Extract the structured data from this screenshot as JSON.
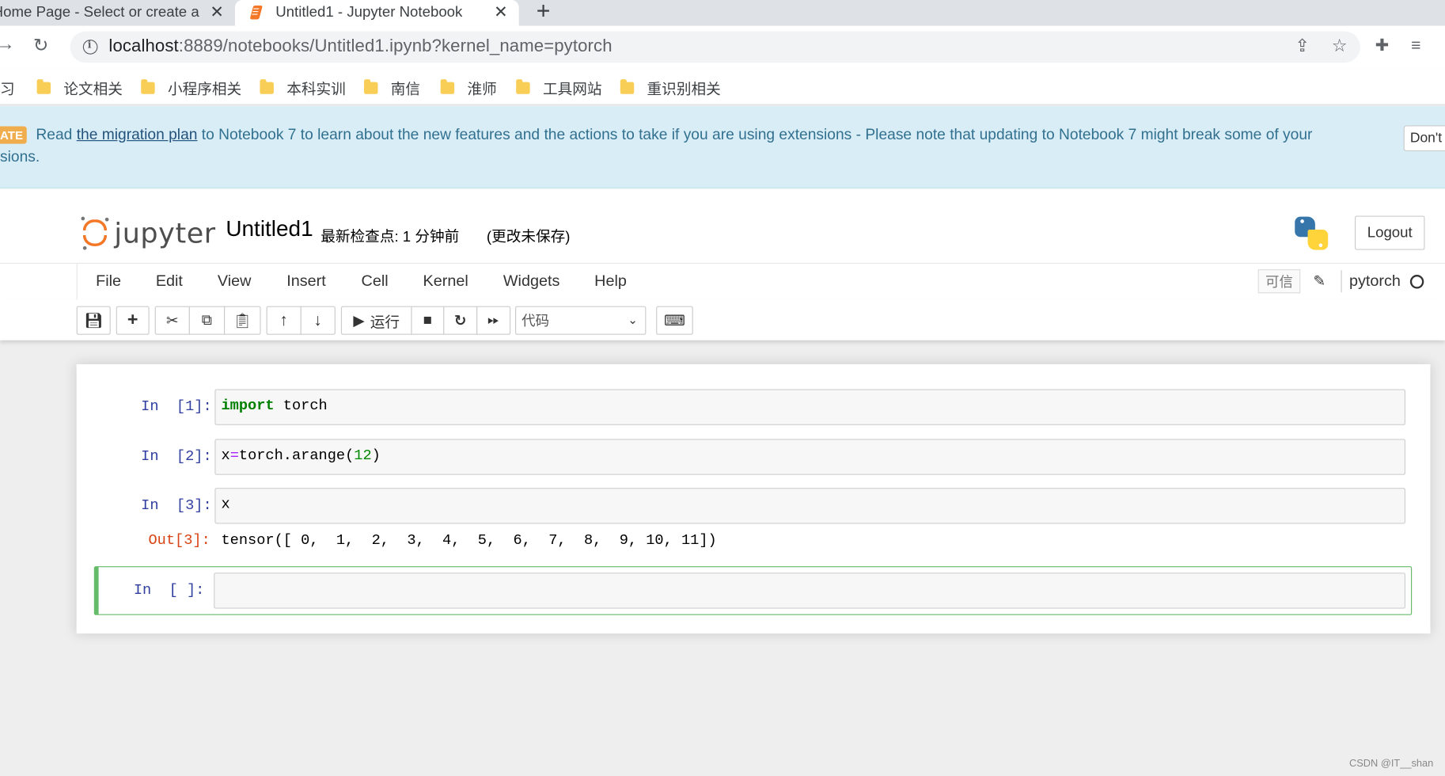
{
  "browser": {
    "tabs": [
      {
        "title": "Home Page - Select or create a",
        "close": "✕"
      },
      {
        "title": "Untitled1 - Jupyter Notebook",
        "close": "✕"
      }
    ],
    "new_tab": "+",
    "url_host": "localhost",
    "url_rest": ":8889/notebooks/Untitled1.ipynb?kernel_name=pytorch",
    "bookmarks_first": "习",
    "bookmarks": [
      "论文相关",
      "小程序相关",
      "本科实训",
      "南信",
      "淮师",
      "工具网站",
      "重识别相关"
    ]
  },
  "notice": {
    "badge": "ATE",
    "prefix": "Read ",
    "link": "the migration plan",
    "line1_rest": " to Notebook 7 to learn about the new features and the actions to take if you are using extensions - Please note that updating to Notebook 7 might break some of your",
    "line2": "sions.",
    "dont_button": "Don't show anymore"
  },
  "header": {
    "logo_text": "jupyter",
    "notebook_title": "Untitled1",
    "checkpoint": "最新检查点: 1 分钟前",
    "unsaved": "(更改未保存)",
    "logout": "Logout"
  },
  "menu": {
    "items": [
      "File",
      "Edit",
      "View",
      "Insert",
      "Cell",
      "Kernel",
      "Widgets",
      "Help"
    ],
    "trusted": "可信",
    "kernel_name": "pytorch"
  },
  "toolbar": {
    "run_label": "运行",
    "cell_type": "代码"
  },
  "cells": [
    {
      "prompt": "In  [1]:",
      "code_kw": "import",
      "code_rest": " torch"
    },
    {
      "prompt": "In  [2]:",
      "code_a": "x",
      "code_op": "=",
      "code_b": "torch.arange(",
      "code_num": "12",
      "code_c": ")"
    },
    {
      "prompt": "In  [3]:",
      "code": "x",
      "out_prompt": "Out[3]:",
      "output": "tensor([ 0,  1,  2,  3,  4,  5,  6,  7,  8,  9, 10, 11])"
    },
    {
      "prompt": "In  [ ]:",
      "code": ""
    }
  ],
  "watermark": "CSDN @IT__shan"
}
